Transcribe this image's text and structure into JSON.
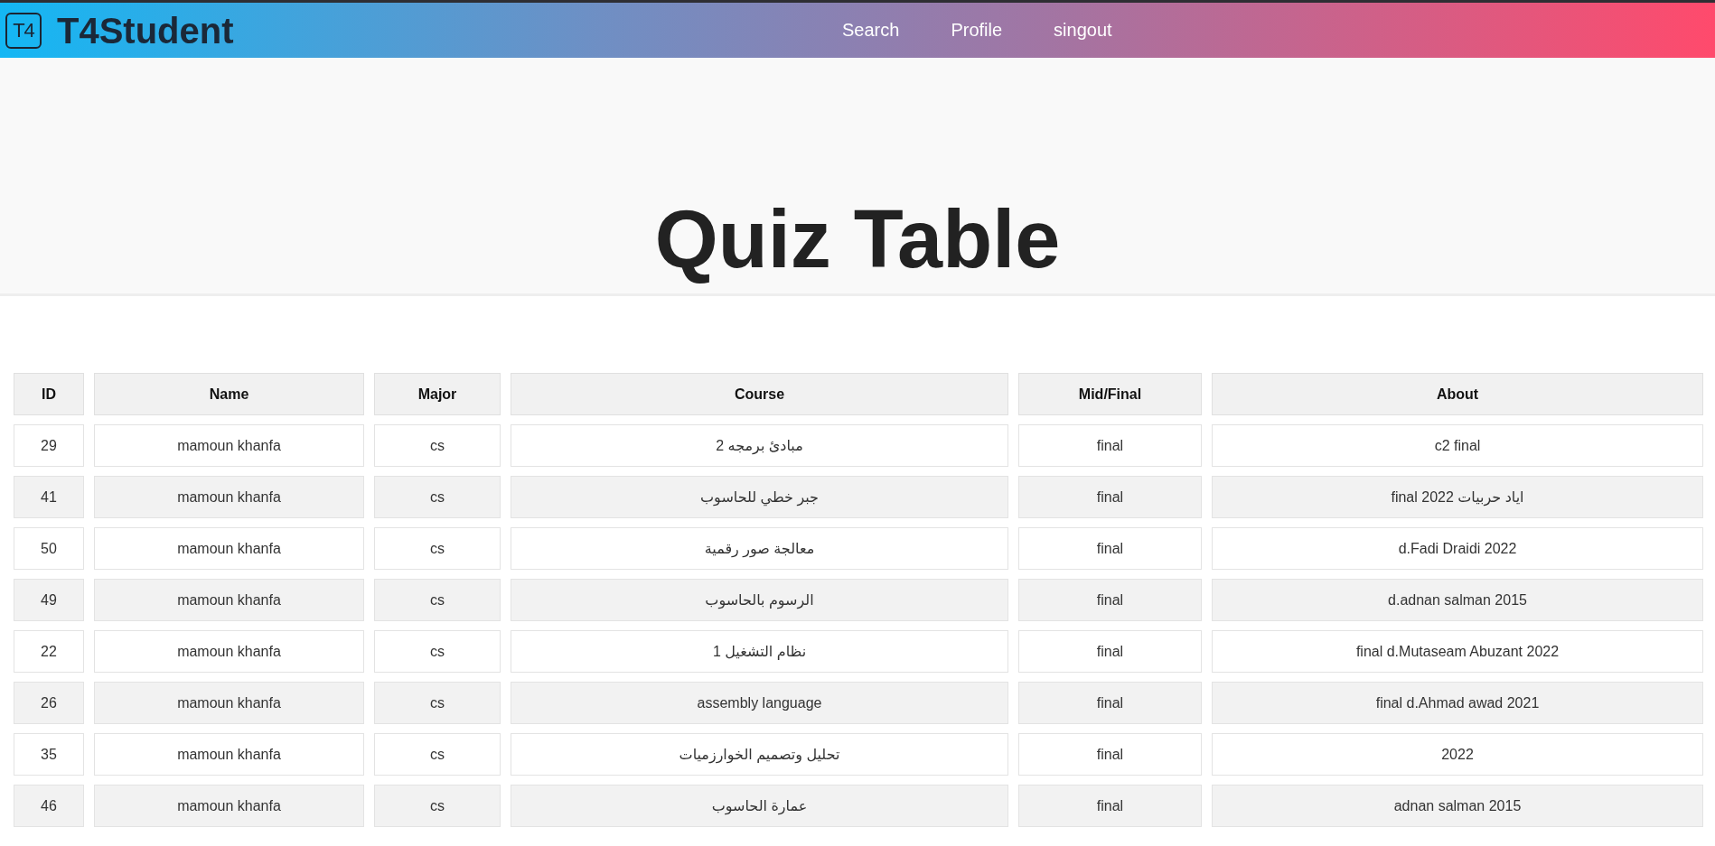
{
  "header": {
    "logo_mark": "T4",
    "brand": "T4Student",
    "nav": [
      {
        "label": "Search"
      },
      {
        "label": "Profile"
      },
      {
        "label": "singout"
      }
    ]
  },
  "page_title": "Quiz Table",
  "table": {
    "columns": [
      "ID",
      "Name",
      "Major",
      "Course",
      "Mid/Final",
      "About"
    ],
    "rows": [
      [
        "29",
        "mamoun khanfa",
        "cs",
        "مبادئ برمجه 2",
        "final",
        "c2 final"
      ],
      [
        "41",
        "mamoun khanfa",
        "cs",
        "جبر خطي للحاسوب",
        "final",
        "final 2022 اياد حربيات"
      ],
      [
        "50",
        "mamoun khanfa",
        "cs",
        "معالجة صور رقمية",
        "final",
        "d.Fadi Draidi 2022"
      ],
      [
        "49",
        "mamoun khanfa",
        "cs",
        "الرسوم بالحاسوب",
        "final",
        "d.adnan salman 2015"
      ],
      [
        "22",
        "mamoun khanfa",
        "cs",
        "نظام التشغيل 1",
        "final",
        "final d.Mutaseam Abuzant 2022"
      ],
      [
        "26",
        "mamoun khanfa",
        "cs",
        "assembly language",
        "final",
        "final d.Ahmad awad 2021"
      ],
      [
        "35",
        "mamoun khanfa",
        "cs",
        "تحليل وتصميم الخوارزميات",
        "final",
        "2022"
      ],
      [
        "46",
        "mamoun khanfa",
        "cs",
        "عمارة الحاسوب",
        "final",
        "adnan salman 2015"
      ]
    ]
  }
}
